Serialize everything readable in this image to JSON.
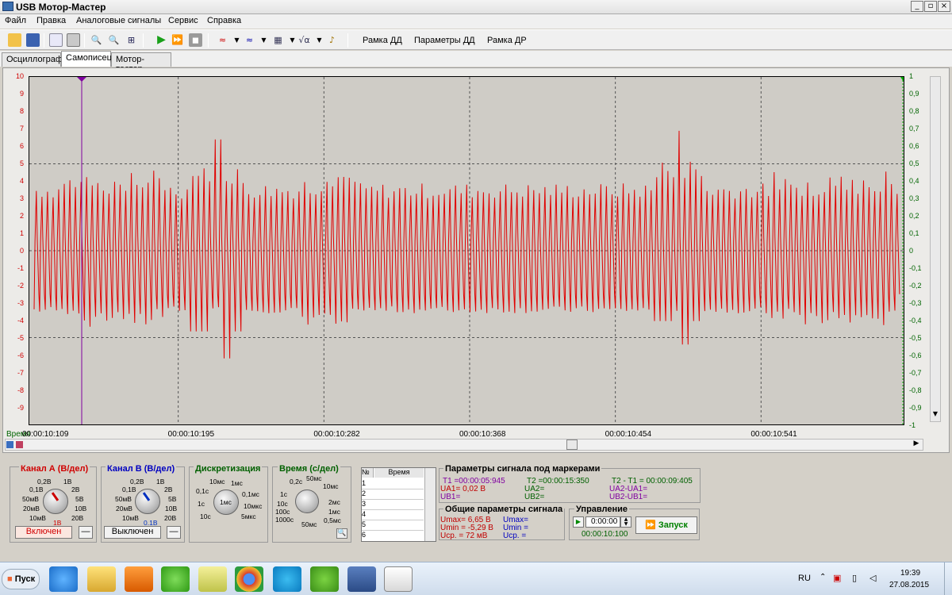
{
  "window": {
    "title": "USB Мотор-Мастер",
    "buttons": [
      "_",
      "▫",
      "×"
    ]
  },
  "menu": [
    {
      "label": "Файл"
    },
    {
      "label": "Правка"
    },
    {
      "label": "Аналоговые сигналы"
    },
    {
      "label": "Сервис"
    },
    {
      "label": "Справка"
    }
  ],
  "toolbar": {
    "frame_dd": "Рамка ДД",
    "params_dd": "Параметры ДД",
    "frame_dr": "Рамка ДР"
  },
  "tabs": [
    {
      "label": "Осциллограф"
    },
    {
      "label": "Самописец"
    },
    {
      "label": "Мотор-тестер"
    }
  ],
  "chart_data": {
    "type": "line",
    "y_left_ticks": [
      "10",
      "9",
      "8",
      "7",
      "6",
      "5",
      "4",
      "3",
      "2",
      "1",
      "0",
      "-1",
      "-2",
      "-3",
      "-4",
      "-5",
      "-6",
      "-7",
      "-8",
      "-9"
    ],
    "y_right_ticks": [
      "1",
      "0,9",
      "0,8",
      "0,7",
      "0,6",
      "0,5",
      "0,4",
      "0,3",
      "0,2",
      "0,1",
      "0",
      "-0,1",
      "-0,2",
      "-0,3",
      "-0,4",
      "-0,5",
      "-0,6",
      "-0,7",
      "-0,8",
      "-0,9",
      "-1"
    ],
    "ylim_left": [
      -10,
      10
    ],
    "ylim_right": [
      -1,
      1
    ],
    "x_ticks": [
      "00:00:10:109",
      "00:00:10:195",
      "00:00:10:282",
      "00:00:10:368",
      "00:00:10:454",
      "00:00:10:541"
    ],
    "x_axis_label": "Время",
    "series": [
      {
        "color": "#e00000",
        "typical_max": 3.3,
        "typical_min": -3.4,
        "cycles": 155,
        "spikes": [
          {
            "x": 0.21,
            "max": 6.4,
            "min": -6.2
          },
          {
            "x": 0.74,
            "max": 6.9,
            "min": -5.4
          }
        ]
      }
    ],
    "marker_color": "#8000a0",
    "grid": true
  },
  "channelA": {
    "title": "Канал А (В/дел)",
    "labels": [
      "0,2В",
      "1В",
      "0,1В",
      "2В",
      "50мВ",
      "5В",
      "20мВ",
      "10В",
      "10мВ",
      "20В"
    ],
    "value": "1В",
    "button": "Включен",
    "minus": "—"
  },
  "channelB": {
    "title": "Канал В (В/дел)",
    "labels": [
      "0,2В",
      "1В",
      "0,1В",
      "2В",
      "50мВ",
      "5В",
      "20мВ",
      "10В",
      "10мВ",
      "20В"
    ],
    "value": "0.1В",
    "button": "Выключен",
    "minus": "—"
  },
  "sampling": {
    "title": "Дискретизация",
    "labels": [
      "10мс",
      "1мс",
      "0,1с",
      "0,1мс",
      "1с",
      "10мкс",
      "10с",
      "5мкс"
    ],
    "value": "1мс"
  },
  "time": {
    "title": "Время (с/дел)",
    "labels": [
      "0,2с",
      "50мс",
      "1с",
      "10мс",
      "10с",
      "2мс",
      "100с",
      "1мс",
      "1000с",
      "0,5мс",
      "50мс"
    ]
  },
  "marker_table": {
    "col_num": "№",
    "col_time": "Время",
    "rows": [
      "1",
      "2",
      "3",
      "4",
      "5",
      "6"
    ]
  },
  "marker_params": {
    "title": "Параметры сигнала под маркерами",
    "t1": "T1 =00:00:05:945",
    "ua1": "UA1= 0,02 В",
    "ub1": "UB1=",
    "t2": "T2 =00:00:15:350",
    "ua2": "UA2=",
    "ub2": "UB2=",
    "t21": "T2 - T1 = 00:00:09:405",
    "ua21": "UA2-UA1=",
    "ub21": "UB2-UB1="
  },
  "general_params": {
    "title": "Общие параметры сигнала",
    "umax_a": "Umax= 6,65 В",
    "umin_a": "Umin = -5,29 В",
    "ucp_a": "Uср. = 72 мВ",
    "umax_b": "Umax=",
    "umin_b": "Umin =",
    "ucp_b": "Uср. ="
  },
  "control": {
    "title": "Управление",
    "time_value": "0:00:00",
    "start": "Запуск",
    "elapsed": "00:00:10:100"
  },
  "taskbar": {
    "start": "Пуск",
    "lang": "RU",
    "time": "19:39",
    "date": "27.08.2015"
  }
}
